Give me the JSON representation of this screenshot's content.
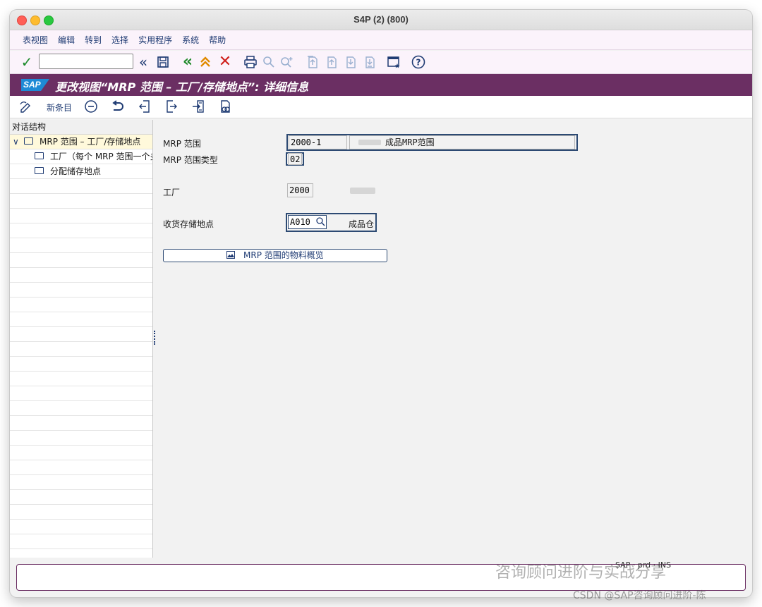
{
  "window": {
    "title": "S4P (2) (800)"
  },
  "menu": [
    "表视图",
    "编辑",
    "转到",
    "选择",
    "实用程序",
    "系统",
    "帮助"
  ],
  "toolbar": {
    "command_value": ""
  },
  "header": {
    "title": "更改视图“MRP 范围 – 工厂/存储地点”: 详细信息",
    "logo": "SAP"
  },
  "app_toolbar": {
    "new_entries": "新条目"
  },
  "tree": {
    "header": "对话结构",
    "items": [
      {
        "label": "MRP 范围 – 工厂/存储地点"
      },
      {
        "label": "工厂（每个 MRP 范围一个多"
      },
      {
        "label": "分配储存地点"
      }
    ]
  },
  "form": {
    "mrp_area_label": "MRP 范围",
    "mrp_area_value": "2000-1",
    "mrp_area_desc": "成品MRP范围",
    "mrp_area_type_label": "MRP 范围类型",
    "mrp_area_type_value": "02",
    "plant_label": "工厂",
    "plant_value": "2000",
    "recv_sloc_label": "收货存储地点",
    "recv_sloc_value": "A010",
    "recv_sloc_desc": "成品仓",
    "overview_button": "MRP 范围的物料概览"
  },
  "status": {
    "info": "SAP  ·  prd  ·  INS"
  },
  "watermark": {
    "line1": "咨询顾问进阶与实战分享",
    "line2": "CSDN @SAP咨询顾问进阶-陈"
  }
}
